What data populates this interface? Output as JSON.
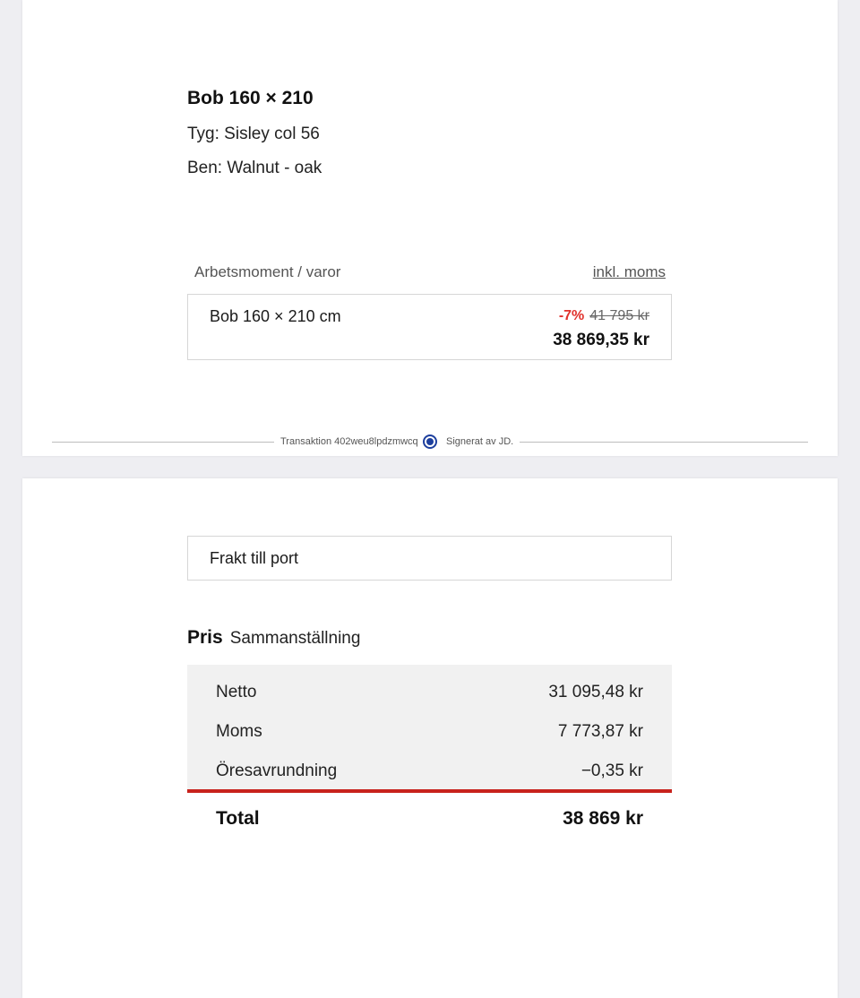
{
  "product": {
    "title": "Bob 160 × 210",
    "fabric": "Tyg: Sisley col 56",
    "legs": "Ben: Walnut - oak"
  },
  "items_table": {
    "header_left": "Arbetsmoment / varor",
    "header_right": "inkl. moms",
    "rows": [
      {
        "name": "Bob 160 × 210 cm",
        "discount": "-7%",
        "original_price": "41 795 kr",
        "price": "38 869,35 kr"
      }
    ]
  },
  "signature": {
    "transaction": "Transaktion 402weu8lpdzmwcq",
    "signed_by": "Signerat av JD.",
    "accent_color": "#1d3f9e"
  },
  "shipping": {
    "label": "Frakt till port"
  },
  "summary": {
    "heading_strong": "Pris",
    "heading_sub": "Sammanställning",
    "rows": [
      {
        "label": "Netto",
        "value": "31 095,48 kr"
      },
      {
        "label": "Moms",
        "value": "7 773,87 kr"
      },
      {
        "label": "Öresavrundning",
        "value": "−0,35 kr"
      }
    ],
    "total_label": "Total",
    "total_value": "38 869 kr",
    "total_line_color": "#c8221c",
    "discount_color": "#e1322c"
  }
}
